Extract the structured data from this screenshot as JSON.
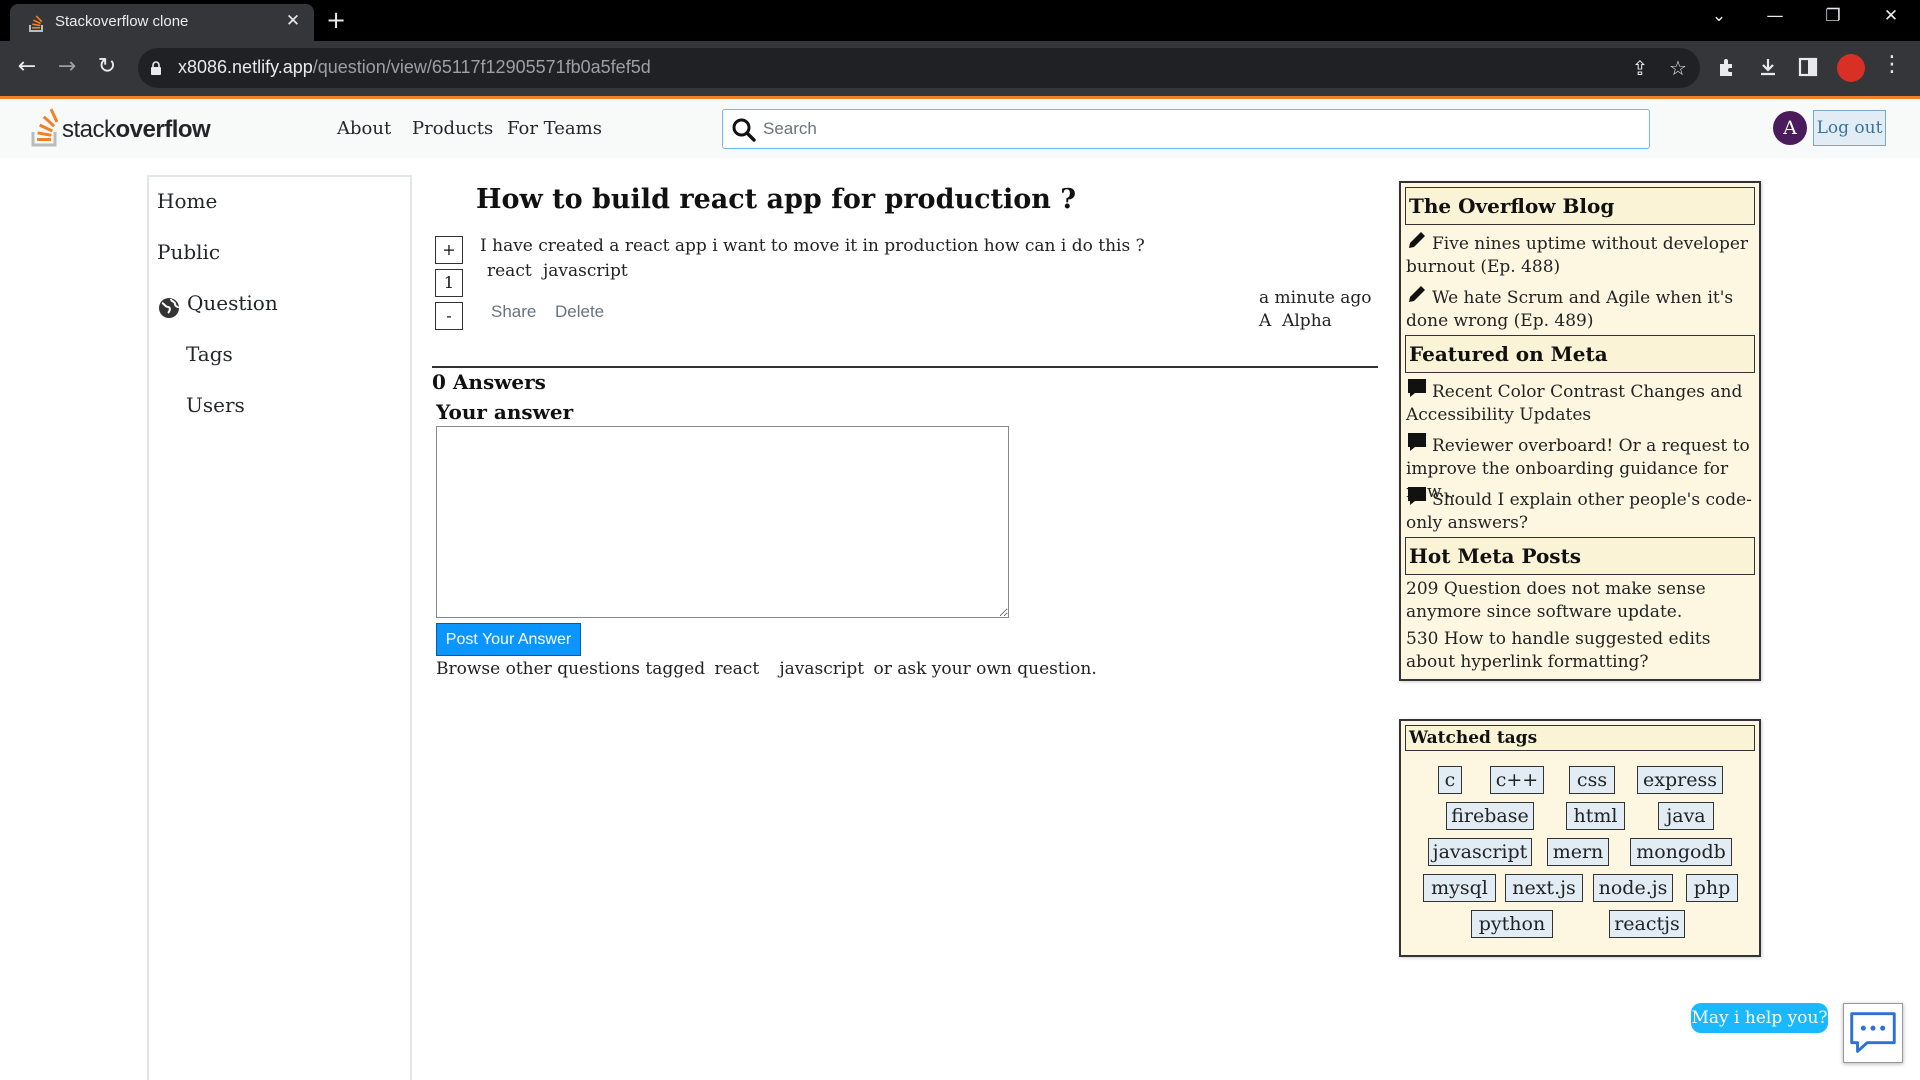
{
  "browser": {
    "tab_title": "Stackoverflow clone",
    "tab_close": "✕",
    "new_tab": "+",
    "url_host": "x8086.netlify.app",
    "url_path": "/question/view/65117f12905571fb0a5fef5d",
    "icons": [
      "back-icon",
      "forward-icon",
      "reload-icon",
      "lock-icon",
      "share-icon",
      "star-icon",
      "extensions-icon",
      "download-icon",
      "sidepanel-icon",
      "profile-icon",
      "menu-icon"
    ],
    "window_controls": {
      "tabsearch": "⌄",
      "minimize": "—",
      "restore": "❐",
      "close": "✕"
    }
  },
  "header": {
    "logo_light": "stack",
    "logo_bold": "overflow",
    "nav": [
      "About",
      "Products",
      "For Teams"
    ],
    "search_placeholder": "Search",
    "avatar_letter": "A",
    "logout_label": "Log out"
  },
  "sidebar": {
    "items": [
      "Home",
      "Public",
      "Question",
      "Tags",
      "Users"
    ]
  },
  "question": {
    "title": "How to build react app for production ?",
    "body": "I have created a react app i want to move it in production how can i do this ?",
    "tags": [
      "react",
      "javascript"
    ],
    "vote_up": "+",
    "vote_count": "1",
    "vote_down": "-",
    "share_label": "Share",
    "delete_label": "Delete",
    "asked_time": "a minute ago",
    "author_initial": "A",
    "author_name": "Alpha"
  },
  "answers": {
    "count_label": "0 Answers",
    "your_answer_label": "Your answer",
    "post_button": "Post Your Answer",
    "browse_prefix": "Browse other questions tagged",
    "browse_tags": [
      "react",
      "javascript"
    ],
    "browse_suffix": "or ask your own question."
  },
  "widget": {
    "blog_title": "The Overflow Blog",
    "blog_items": [
      "Five nines uptime without developer burnout (Ep. 488)",
      "We hate Scrum and Agile when it's done wrong (Ep. 489)"
    ],
    "meta_title": "Featured on Meta",
    "meta_items": [
      "Recent Color Contrast Changes and Accessibility Updates",
      "Reviewer overboard! Or a request to improve the onboarding guidance for new...",
      "Should I explain other people's code-only answers?"
    ],
    "hot_title": "Hot Meta Posts",
    "hot_items": [
      "209 Question does not make sense anymore since software update.",
      "530 How to handle suggested edits about hyperlink formatting?"
    ]
  },
  "watched": {
    "title": "Watched tags",
    "tags": [
      "c",
      "c++",
      "css",
      "express",
      "firebase",
      "html",
      "java",
      "javascript",
      "mern",
      "mongodb",
      "mysql",
      "next.js",
      "node.js",
      "php",
      "python",
      "reactjs"
    ]
  },
  "chat": {
    "bubble": "May i help you?"
  },
  "colors": {
    "accent": "#f48024",
    "button_blue": "#0a95ff",
    "widget_bg": "#fdf7e2",
    "tag_bg": "#e1ecf4"
  }
}
